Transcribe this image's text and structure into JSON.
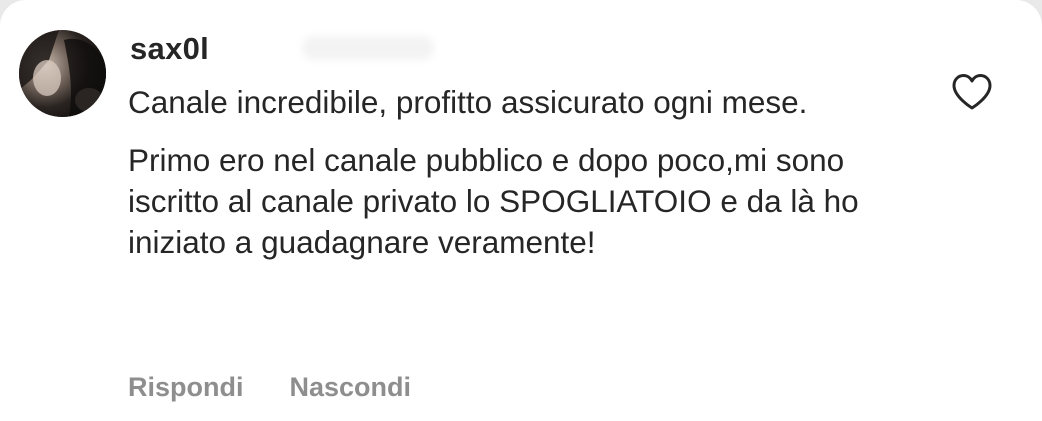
{
  "comment": {
    "username": "sax0l",
    "paragraphs": [
      "Canale incredibile, profitto assicurato ogni mese.",
      "Primo ero nel canale pubblico e dopo poco,mi sono iscritto al canale privato lo SPOGLIATOIO e da là ho iniziato a guadagnare veramente!"
    ],
    "actions": {
      "reply_label": "Rispondi",
      "hide_label": "Nascondi"
    },
    "like_icon": "heart-outline-icon"
  },
  "colors": {
    "text": "#262626",
    "secondary_text": "#8e8e8e",
    "background": "#ffffff"
  }
}
